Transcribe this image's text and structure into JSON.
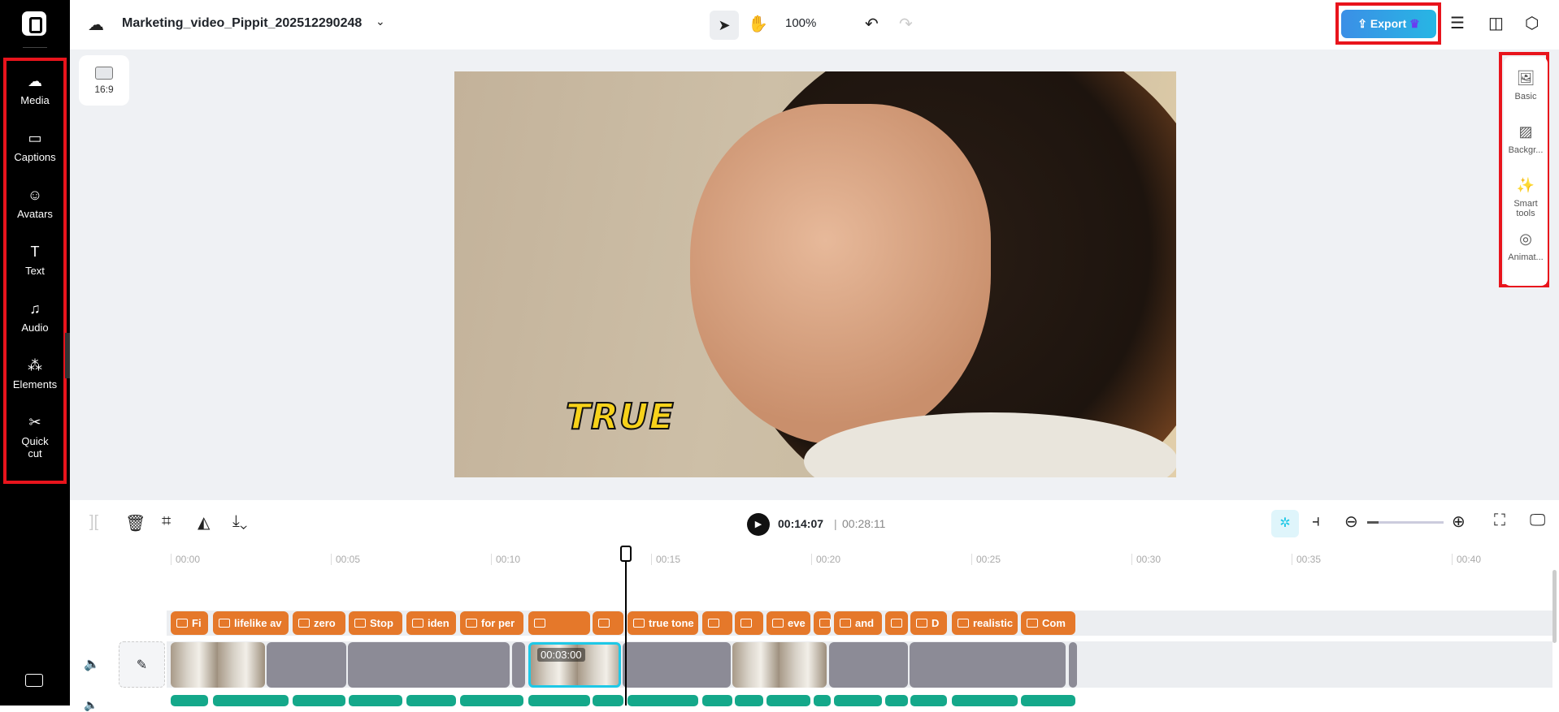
{
  "project_title": "Marketing_video_Pippit_202512290248",
  "zoom": "100%",
  "export_label": "Export",
  "aspect_ratio": "16:9",
  "sidebar": {
    "items": [
      {
        "label": "Media",
        "icon": "cloud-upload-icon"
      },
      {
        "label": "Captions",
        "icon": "captions-icon"
      },
      {
        "label": "Avatars",
        "icon": "avatar-icon"
      },
      {
        "label": "Text",
        "icon": "text-icon"
      },
      {
        "label": "Audio",
        "icon": "music-icon"
      },
      {
        "label": "Elements",
        "icon": "elements-icon"
      },
      {
        "label": "Quick cut",
        "icon": "scissors-icon"
      }
    ]
  },
  "right_panel": {
    "items": [
      {
        "label": "Basic",
        "icon": "image-icon"
      },
      {
        "label": "Backgr...",
        "icon": "background-icon"
      },
      {
        "label": "Smart tools",
        "icon": "magic-wand-icon"
      },
      {
        "label": "Animat...",
        "icon": "animation-icon"
      }
    ]
  },
  "preview_caption": "TRUE",
  "playback": {
    "current": "00:14:07",
    "total": "00:28:11"
  },
  "ruler": [
    "00:00",
    "00:05",
    "00:10",
    "00:15",
    "00:20",
    "00:25",
    "00:30",
    "00:35",
    "00:40"
  ],
  "captions": [
    "Fi",
    "lifelike av",
    "zero",
    "Stop",
    "iden",
    "for per",
    "",
    "",
    "true tone",
    "",
    "",
    "eve",
    "",
    "and",
    "",
    "D",
    "realistic",
    "Com"
  ],
  "selected_clip_duration": "00:03:00",
  "colors": {
    "caption": "#e5782a",
    "audio": "#14a88a",
    "selected": "#1ec8e6",
    "export": "#3b8fe6"
  }
}
